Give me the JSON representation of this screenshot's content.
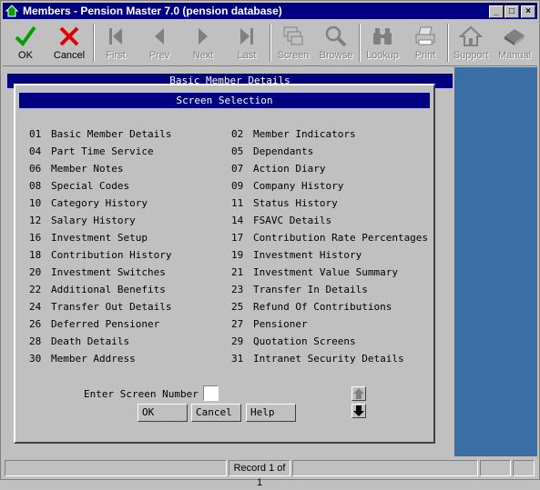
{
  "window": {
    "title": "Members - Pension Master 7.0 (pension database)",
    "controls": {
      "minimize": "_",
      "maximize": "□",
      "close": "×"
    }
  },
  "toolbar": {
    "ok": "OK",
    "cancel": "Cancel",
    "first": "First",
    "prev": "Prev",
    "next": "Next",
    "last": "Last",
    "screen": "Screen",
    "browse": "Browse",
    "lookup": "Lookup",
    "print": "Print",
    "support": "Support",
    "manual": "Manual"
  },
  "background": {
    "header": "Basic Member Details"
  },
  "dialog": {
    "title": "Screen Selection",
    "left_screens": [
      {
        "num": "01",
        "name": "Basic Member Details"
      },
      {
        "num": "04",
        "name": "Part Time Service"
      },
      {
        "num": "06",
        "name": "Member Notes"
      },
      {
        "num": "08",
        "name": "Special Codes"
      },
      {
        "num": "10",
        "name": "Category History"
      },
      {
        "num": "12",
        "name": "Salary History"
      },
      {
        "num": "16",
        "name": "Investment Setup"
      },
      {
        "num": "18",
        "name": "Contribution History"
      },
      {
        "num": "20",
        "name": "Investment Switches"
      },
      {
        "num": "22",
        "name": "Additional Benefits"
      },
      {
        "num": "24",
        "name": "Transfer Out Details"
      },
      {
        "num": "26",
        "name": "Deferred Pensioner"
      },
      {
        "num": "28",
        "name": "Death Details"
      },
      {
        "num": "30",
        "name": "Member Address"
      }
    ],
    "right_screens": [
      {
        "num": "02",
        "name": "Member Indicators"
      },
      {
        "num": "05",
        "name": "Dependants"
      },
      {
        "num": "07",
        "name": "Action Diary"
      },
      {
        "num": "09",
        "name": "Company History"
      },
      {
        "num": "11",
        "name": "Status History"
      },
      {
        "num": "14",
        "name": "FSAVC Details"
      },
      {
        "num": "17",
        "name": "Contribution Rate Percentages"
      },
      {
        "num": "19",
        "name": "Investment History"
      },
      {
        "num": "21",
        "name": "Investment Value Summary"
      },
      {
        "num": "23",
        "name": "Transfer In Details"
      },
      {
        "num": "25",
        "name": "Refund Of Contributions"
      },
      {
        "num": "27",
        "name": "Pensioner"
      },
      {
        "num": "29",
        "name": "Quotation Screens"
      },
      {
        "num": "31",
        "name": "Intranet Security Details"
      }
    ],
    "enter_label": "Enter Screen Number",
    "screen_number_value": "",
    "ok_label": "OK",
    "cancel_label": "Cancel",
    "help_label": "Help"
  },
  "status": {
    "record": "Record 1 of 1"
  },
  "colors": {
    "titlebar": "#000080",
    "desktop_panel": "#3a6ea5",
    "face": "#c0c0c0",
    "ok_green": "#00a000",
    "cancel_red": "#e00000"
  }
}
